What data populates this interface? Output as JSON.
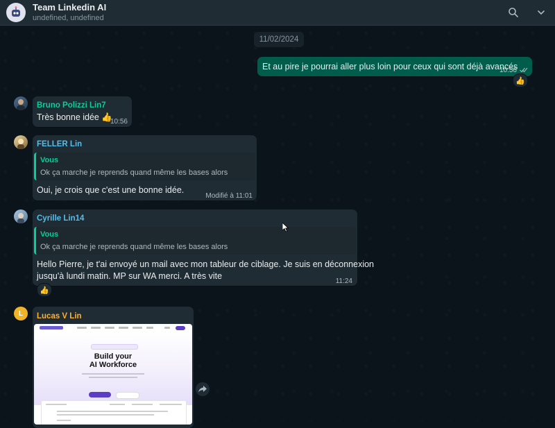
{
  "header": {
    "title": "Team Linkedin AI",
    "subtitle": "undefined, undefined",
    "search_icon": "search-icon",
    "menu_icon": "chevron-down-icon"
  },
  "date_separator": "11/02/2024",
  "messages": [
    {
      "direction": "out",
      "text": "Et au pire je pourrai aller plus loin pour ceux qui sont déjà avancés",
      "time": "10:56",
      "status": "read",
      "reaction": "👍"
    },
    {
      "direction": "in",
      "sender": "Bruno Polizzi Lin7",
      "sender_color": "#06cf9c",
      "text": "Très bonne idée 👍",
      "time": "10:56"
    },
    {
      "direction": "in",
      "sender": "FELLER Lin",
      "sender_color": "#53bdeb",
      "quote": {
        "author": "Vous",
        "text": "Ok ça marche je reprends quand même les bases alors"
      },
      "text": "Oui, je crois que c'est une bonne idée.",
      "time": "Modifié à 11:01"
    },
    {
      "direction": "in",
      "sender": "Cyrille Lin14",
      "sender_color": "#53bdeb",
      "quote": {
        "author": "Vous",
        "text": "Ok ça marche je reprends quand même les bases alors"
      },
      "text_line1": "Hello Pierre, je t'ai envoyé un mail avec mon tableur de ciblage. Je suis en déconnexion",
      "text_line2": "jusqu'à lundi matin. MP sur WA  merci. A très vite",
      "time": "11:24",
      "reaction": "👍"
    },
    {
      "direction": "in",
      "sender": "Lucas V Lin",
      "sender_color": "#ffb02e",
      "avatar_letter": "L",
      "image": {
        "hero_title_line1": "Build your",
        "hero_title_line2": "AI Workforce"
      }
    }
  ],
  "colors": {
    "background": "#0b141a",
    "incoming_bubble": "#202c33",
    "outgoing_bubble": "#005c4b",
    "quote_accent": "#06cf9c"
  }
}
